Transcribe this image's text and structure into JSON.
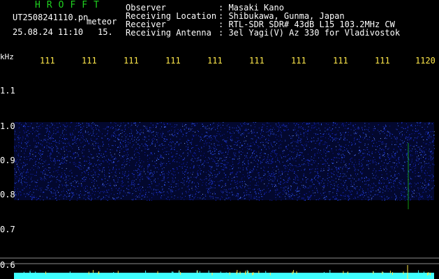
{
  "header": {
    "brand": "HROFFT",
    "file_name": "UT2508241110.pn",
    "category": "meteor",
    "datetime": "25.08.24 11:10",
    "count": "15.",
    "info_rows": [
      {
        "label": "Observer",
        "value": ": Masaki Kano"
      },
      {
        "label": "Receiving Location",
        "value": ": Shibukawa, Gunma, Japan"
      },
      {
        "label": "Receiver",
        "value": ": RTL-SDR SDR# 43dB L15 103.2MHz CW"
      },
      {
        "label": "Receiving Antenna",
        "value": ": 3el Yagi(V) Az 330 for Vladivostok"
      }
    ]
  },
  "time_axis": {
    "labels": [
      "111",
      "111",
      "111",
      "111",
      "111",
      "111",
      "111",
      "111",
      "111",
      "1120"
    ]
  },
  "freq_axis": {
    "unit": "kHz",
    "labels": [
      "1.1",
      "1.0",
      "0.9",
      "0.8",
      "0.7",
      "0.6"
    ]
  },
  "colors": {
    "noise_band": "#1a2fd8",
    "header_text": "#ffffff",
    "brand_text": "#1fd21f",
    "axis_text": "#ffe84a",
    "meteor_strip": "#40ffff"
  }
}
